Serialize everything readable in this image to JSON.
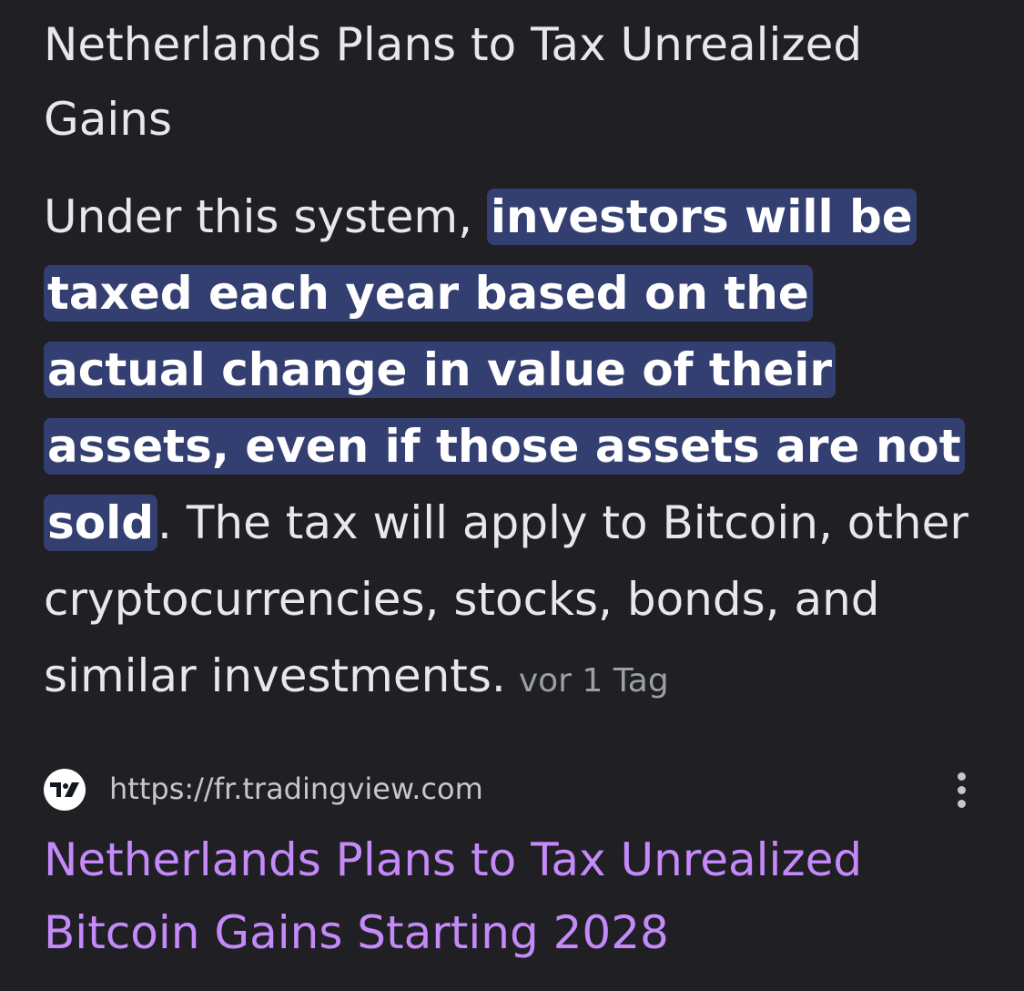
{
  "snippet_heading": "Netherlands Plans to Tax Unrealized Gains",
  "snippet": {
    "before": "Under this system, ",
    "highlight": "investors will be taxed each year based on the actual change in value of their assets, even if those assets are not sold",
    "after": ". The tax will apply to Bitcoin, other cryptocurrencies, stocks, bonds, and similar investments.",
    "date": "vor 1 Tag"
  },
  "source": {
    "favicon": "tradingview-logo",
    "url": "https://fr.tradingview.com"
  },
  "result": {
    "title": "Netherlands Plans to Tax Unrealized Bitcoin Gains Starting 2028"
  },
  "colors": {
    "background": "#1f1f24",
    "highlight": "#343f71",
    "link": "#c58af9"
  }
}
